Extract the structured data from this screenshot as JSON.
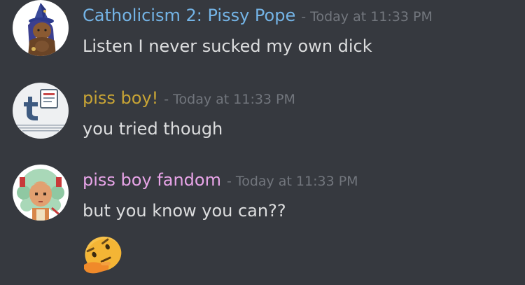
{
  "messages": [
    {
      "author": "Catholicism 2: Pissy Pope",
      "author_color": "#74b4e6",
      "separator": "-",
      "timestamp": "Today at 11:33 PM",
      "content": "Listen I never sucked my own dick",
      "avatar_icon": "witch-hat-character-avatar"
    },
    {
      "author": "piss boy!",
      "author_color": "#c9a535",
      "separator": "-",
      "timestamp": "Today at 11:33 PM",
      "content": "you tried though",
      "avatar_icon": "removed-image-placeholder-avatar"
    },
    {
      "author": "piss boy fandom",
      "author_color": "#e7a4e7",
      "separator": "-",
      "timestamp": "Today at 11:33 PM",
      "content": "but you know you can??",
      "avatar_icon": "pixel-art-girl-avatar",
      "reaction_emoji": "thinking-face-emoji"
    }
  ]
}
